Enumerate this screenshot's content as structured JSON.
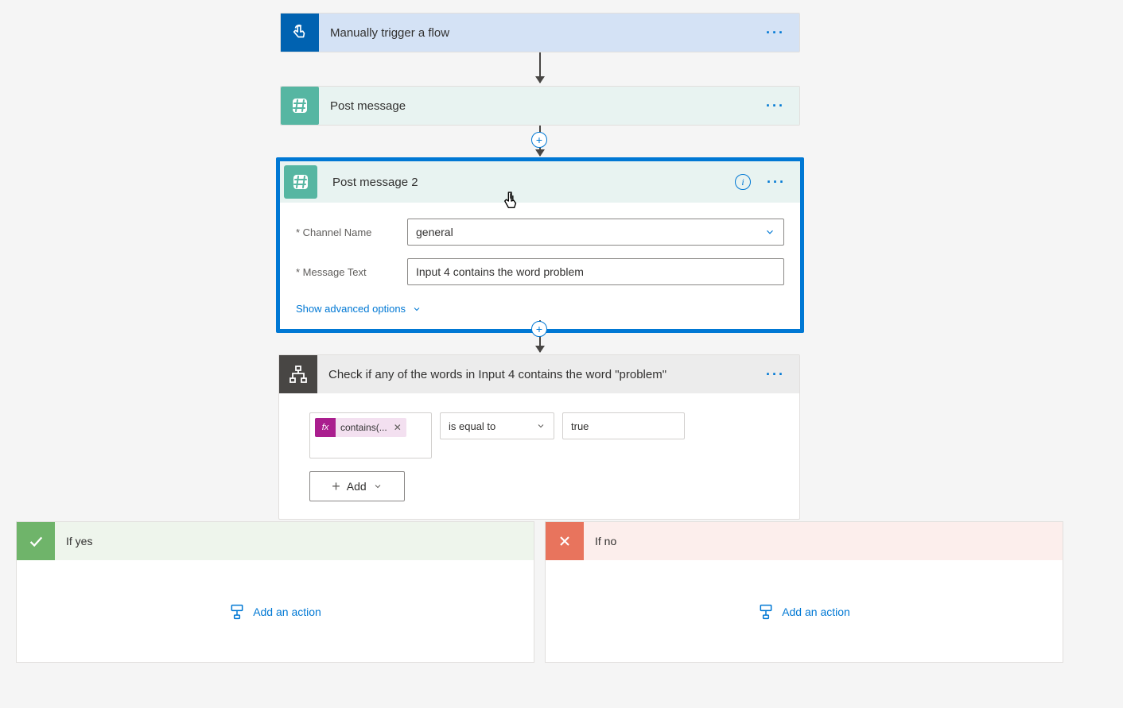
{
  "trigger": {
    "title": "Manually trigger a flow"
  },
  "post1": {
    "title": "Post message"
  },
  "post2": {
    "title": "Post message 2",
    "fields": {
      "channel_label": "Channel Name",
      "channel_value": "general",
      "message_label": "Message Text",
      "message_value": "Input 4 contains the word problem"
    },
    "advanced_link": "Show advanced options"
  },
  "condition": {
    "title": "Check if any of the words in Input 4 contains the word \"problem\"",
    "expression_token": "contains(...",
    "operator": "is equal to",
    "value": "true",
    "add_label": "Add"
  },
  "branches": {
    "yes_label": "If yes",
    "no_label": "If no",
    "add_action": "Add an action"
  }
}
